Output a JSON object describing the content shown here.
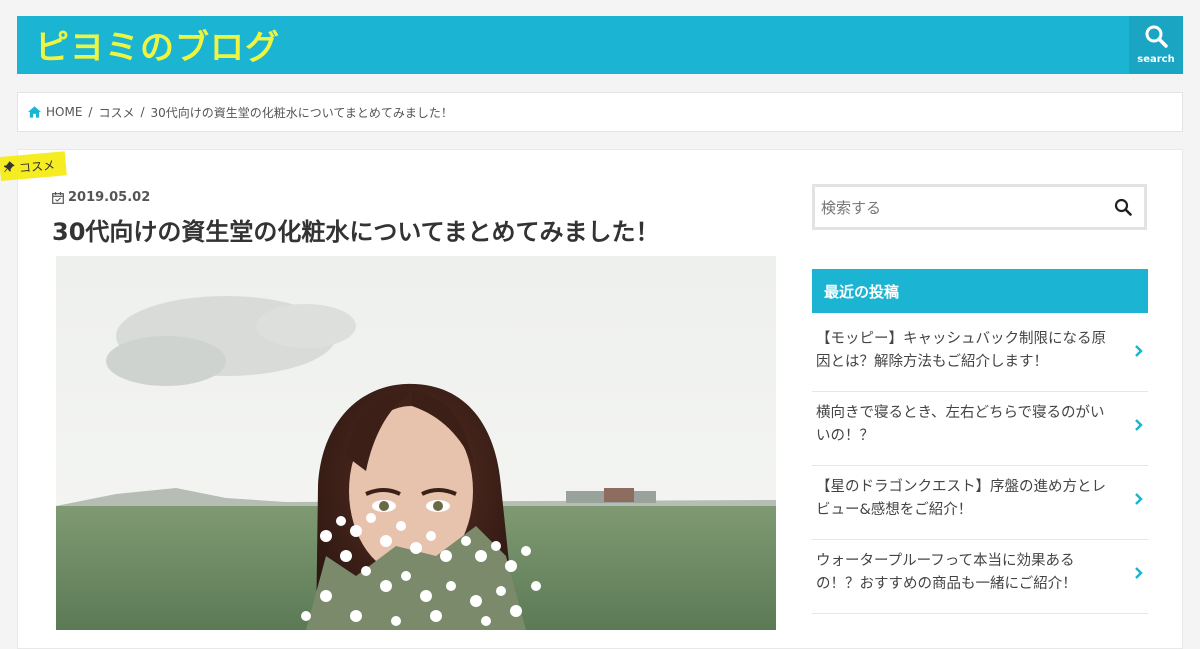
{
  "header": {
    "site_title": "ピヨミのブログ",
    "search_label": "search"
  },
  "breadcrumb": {
    "home": "HOME",
    "category": "コスメ",
    "current": "30代向けの資生堂の化粧水についてまとめてみました！"
  },
  "post": {
    "category_tag": "コスメ",
    "date": "2019.05.02",
    "title": "30代向けの資生堂の化粧水についてまとめてみました！"
  },
  "sidebar": {
    "search_placeholder": "検索する",
    "recent_heading": "最近の投稿",
    "recent_posts": [
      "【モッピー】キャッシュバック制限になる原因とは？解除方法もご紹介します！",
      "横向きで寝るとき、左右どちらで寝るのがいいの！？",
      "【星のドラゴンクエスト】序盤の進め方とレビュー&感想をご紹介！",
      "ウォータープルーフって本当に効果あるの！？おすすめの商品も一緒にご紹介！"
    ]
  },
  "colors": {
    "accent": "#1bb4d3",
    "title_yellow": "#eef540",
    "tag_yellow": "#f6ec22"
  }
}
